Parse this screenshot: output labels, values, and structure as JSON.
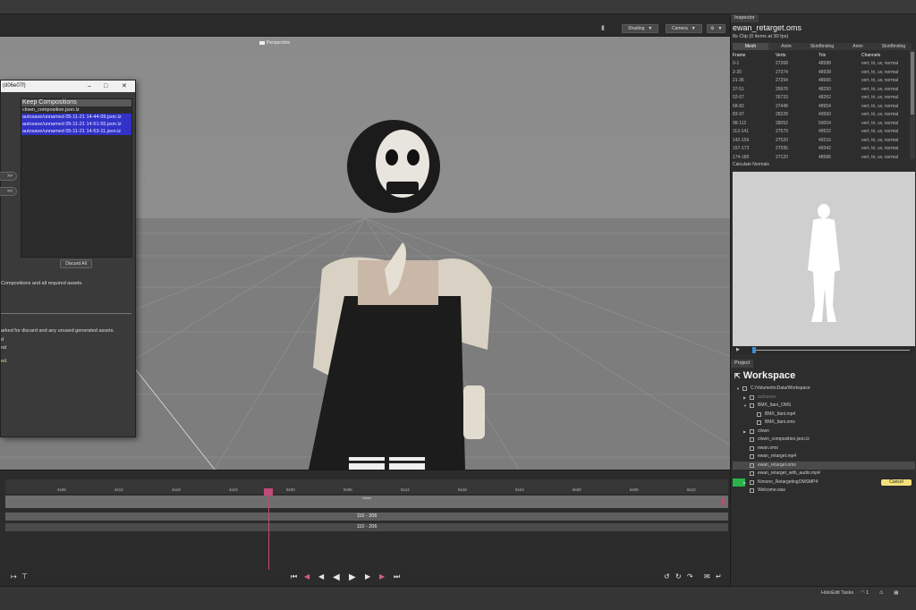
{
  "toolbar": {
    "shading_label": "Shading",
    "camera_label": "Camera"
  },
  "viewport": {
    "camera_mode": "Perspective"
  },
  "dialog": {
    "title": "(d06e07f)",
    "list_header": "Keep Compositions",
    "items": [
      "clown_composition.json.lz",
      "autosave/unnamed 05-11-21 14-44-09.json.lz",
      "autosave/unnamed 05-11-21 14-51-55.json.lz",
      "autosave/unnamed 05-11-21 14-53-11.json.lz"
    ],
    "move_right": ">>",
    "move_left": "<<",
    "discard_all": "Discard All",
    "line1": "Compositions and all required assets.",
    "line2": "arked for discard and any unused generated assets.",
    "line3": "d",
    "line4": "nd",
    "line5": "ed."
  },
  "inspector": {
    "tab": "Inspector",
    "asset_name": "ewan_retarget.oms",
    "clip_info": "8s Clip (0 items at 30 fps)",
    "subtabs": [
      "Mesh",
      "Anim",
      "SkinBinding",
      "Anim",
      "SkinBinding"
    ],
    "columns": [
      "Frame",
      "Verts",
      "Tris",
      "Channels"
    ],
    "rows": [
      [
        "0-1",
        "27268",
        "48588",
        "vert, tri, uv, normal"
      ],
      [
        "2-20",
        "27374",
        "48938",
        "vert, tri, uv, normal"
      ],
      [
        "21-36",
        "27294",
        "48666",
        "vert, tri, uv, normal"
      ],
      [
        "37-51",
        "26976",
        "48250",
        "vert, tri, uv, normal"
      ],
      [
        "52-67",
        "26733",
        "48262",
        "vert, tri, uv, normal"
      ],
      [
        "68-82",
        "27448",
        "48954",
        "vert, tri, uv, normal"
      ],
      [
        "83-97",
        "28228",
        "49560",
        "vert, tri, uv, normal"
      ],
      [
        "98-112",
        "28052",
        "50004",
        "vert, tri, uv, normal"
      ],
      [
        "113-141",
        "27579",
        "49522",
        "vert, tri, uv, normal"
      ],
      [
        "142-156",
        "27520",
        "49216",
        "vert, tri, uv, normal"
      ],
      [
        "157-173",
        "27595",
        "49342",
        "vert, tri, uv, normal"
      ],
      [
        "174-180",
        "27120",
        "48586",
        "vert, tri, uv, normal"
      ]
    ],
    "calc_normals": "Calculate Normals"
  },
  "project": {
    "tab": "Project",
    "title": "Workspace",
    "tree": [
      {
        "name": "C:/VolumetricData/Workspace",
        "indent": 0,
        "type": "folder",
        "open": true
      },
      {
        "name": "autosave",
        "indent": 1,
        "type": "folder",
        "dim": true
      },
      {
        "name": "BMX_Itani_OMS",
        "indent": 1,
        "type": "folder",
        "open": true
      },
      {
        "name": "BMX_Itani.mp4",
        "indent": 2,
        "type": "file"
      },
      {
        "name": "BMX_Itani.oms",
        "indent": 2,
        "type": "file"
      },
      {
        "name": "clown",
        "indent": 1,
        "type": "folder"
      },
      {
        "name": "clown_composition.json.lz",
        "indent": 1,
        "type": "file"
      },
      {
        "name": "ewan.oms",
        "indent": 1,
        "type": "file"
      },
      {
        "name": "ewan_retarget.mp4",
        "indent": 1,
        "type": "file"
      },
      {
        "name": "ewan_retarget.oms",
        "indent": 1,
        "type": "file",
        "highlight": true
      },
      {
        "name": "ewan_retarget_with_audio.mp4",
        "indent": 1,
        "type": "file"
      },
      {
        "name": "Kimono_RetargetingOMSMP4",
        "indent": 1,
        "type": "folder",
        "processing": true
      },
      {
        "name": "Welcome.wav",
        "indent": 1,
        "type": "file"
      }
    ],
    "cancel_label": "Cancel"
  },
  "timeline": {
    "ticks": [
      "4s06",
      "4s12",
      "4s18",
      "4s24",
      "5s00",
      "5s06",
      "5s12",
      "5s18",
      "5s24",
      "6s00",
      "6s06",
      "6s12"
    ],
    "clip_name": "clown",
    "range_upper": "110 - 206",
    "range_lower": "110 - 206"
  },
  "status": {
    "tasks_label": "HoloEdit Tasks",
    "tasks_count": "1"
  }
}
